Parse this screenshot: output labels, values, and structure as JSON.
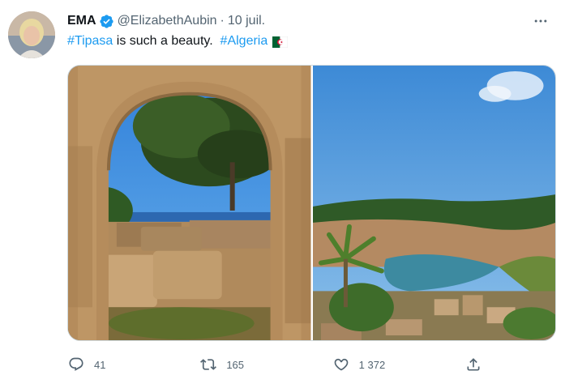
{
  "tweet": {
    "author": {
      "display_name": "EMA",
      "handle": "@ElizabethAubin",
      "separator": "·",
      "date": "10 juil.",
      "verified_icon": "verified-badge-icon",
      "avatar": "avatar-photo"
    },
    "text": {
      "hashtag1": "#Tipasa",
      "middle": " is such a beauty.  ",
      "hashtag2": "#Algeria",
      "flag": "algeria-flag-icon"
    },
    "media": [
      {
        "name": "photo-stone-arch"
      },
      {
        "name": "photo-coastal-cove"
      }
    ],
    "actions": {
      "replies": "41",
      "retweets": "165",
      "likes": "1 372"
    },
    "colors": {
      "accent": "#1d9bf0",
      "secondary_text": "#536471",
      "primary_text": "#0f1419"
    }
  }
}
